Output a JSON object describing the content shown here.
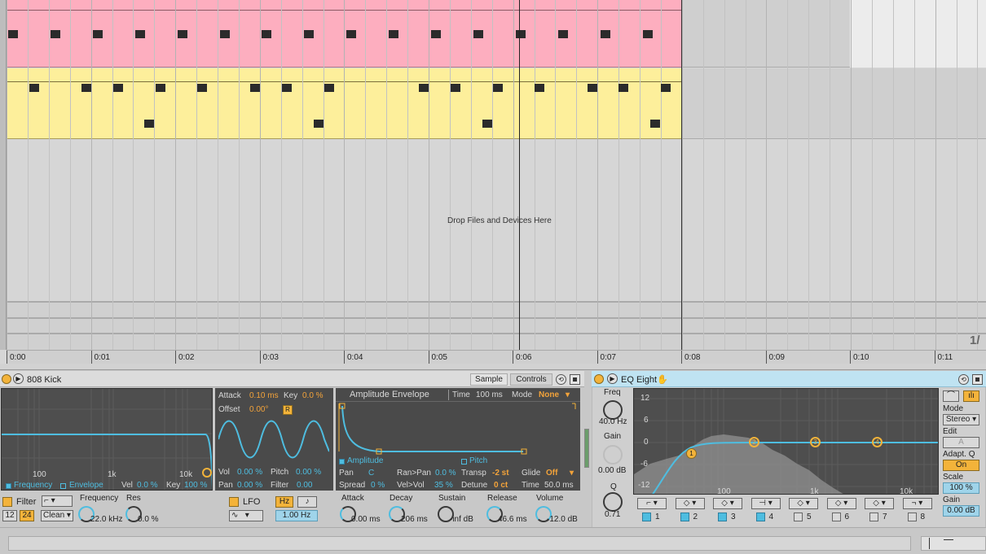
{
  "arrangement": {
    "drop_hint": "Drop Files and Devices Here",
    "loop_end_marker": "1/",
    "ruler_labels": [
      "0:00",
      "0:01",
      "0:02",
      "0:03",
      "0:04",
      "0:05",
      "0:06",
      "0:07",
      "0:08",
      "0:09",
      "0:10",
      "0:11"
    ],
    "clip_colors": {
      "kick_clip": "#fdaebf",
      "snare_clip": "#fdef9b"
    }
  },
  "drum_rack_device": {
    "title": "808 Kick",
    "tabs": {
      "sample": "Sample",
      "controls": "Controls"
    },
    "filter_graph": {
      "freq_labels": [
        "100",
        "1k",
        "10k"
      ],
      "mode_frequency": "Frequency",
      "mode_envelope": "Envelope",
      "vel_label": "Vel",
      "vel_value": "0.0 %",
      "key_label": "Key",
      "key_value": "100 %"
    },
    "filter_controls": {
      "filter_label": "Filter",
      "slope_12": "12",
      "slope_24": "24",
      "circuit": "Clean",
      "frequency_label": "Frequency",
      "frequency_value": "22.0 kHz",
      "res_label": "Res",
      "res_value": "0.0 %"
    },
    "lfo_panel": {
      "attack_label": "Attack",
      "attack_value": "0.10 ms",
      "key_label": "Key",
      "key_value": "0.0 %",
      "offset_label": "Offset",
      "offset_value": "0.00°",
      "retrig": "R",
      "vol_label": "Vol",
      "vol_value": "0.00 %",
      "pitch_label": "Pitch",
      "pitch_value": "0.00 %",
      "pan_label": "Pan",
      "pan_value": "0.00 %",
      "filter_label": "Filter",
      "filter_value": "0.00",
      "lfo_label": "LFO",
      "hz_button": "Hz",
      "sync_button": "♪",
      "rate_value": "1.00 Hz"
    },
    "envelope": {
      "title": "Amplitude Envelope",
      "time_label": "Time",
      "time_value": "100 ms",
      "mode_label": "Mode",
      "mode_value": "None",
      "amplitude_tab": "Amplitude",
      "pitch_tab": "Pitch",
      "pan_label": "Pan",
      "pan_value": "C",
      "ranpan_label": "Ran>Pan",
      "ranpan_value": "0.0 %",
      "transp_label": "Transp",
      "transp_value": "-2 st",
      "glide_label": "Glide",
      "glide_value": "Off",
      "spread_label": "Spread",
      "spread_value": "0 %",
      "velvol_label": "Vel>Vol",
      "velvol_value": "35 %",
      "detune_label": "Detune",
      "detune_value": "0 ct",
      "gtime_label": "Time",
      "gtime_value": "50.0 ms"
    },
    "adsr": {
      "attack_label": "Attack",
      "attack_value": "0.00 ms",
      "decay_label": "Decay",
      "decay_value": "206 ms",
      "sustain_label": "Sustain",
      "sustain_value": "-inf dB",
      "release_label": "Release",
      "release_value": "46.6 ms",
      "volume_label": "Volume",
      "volume_value": "-12.0 dB"
    }
  },
  "eq_device": {
    "title": "EQ Eight",
    "freq_label": "Freq",
    "freq_value": "40.0 Hz",
    "gain_label": "Gain",
    "gain_value": "0.00 dB",
    "q_label": "Q",
    "q_value": "0.71",
    "db_labels": [
      "12",
      "6",
      "0",
      "-6",
      "-12"
    ],
    "freq_labels": [
      "100",
      "1k",
      "10k"
    ],
    "band_points": [
      "1",
      "2",
      "3",
      "4"
    ],
    "band_numbers": [
      "1",
      "2",
      "3",
      "4",
      "5",
      "6",
      "7",
      "8"
    ],
    "mode_label": "Mode",
    "mode_value": "Stereo",
    "edit_label": "Edit",
    "edit_value": "A",
    "adaptq_label": "Adapt. Q",
    "adaptq_value": "On",
    "scale_label": "Scale",
    "scale_value": "100 %",
    "gain_out_label": "Gain",
    "gain_out_value": "0.00 dB"
  }
}
